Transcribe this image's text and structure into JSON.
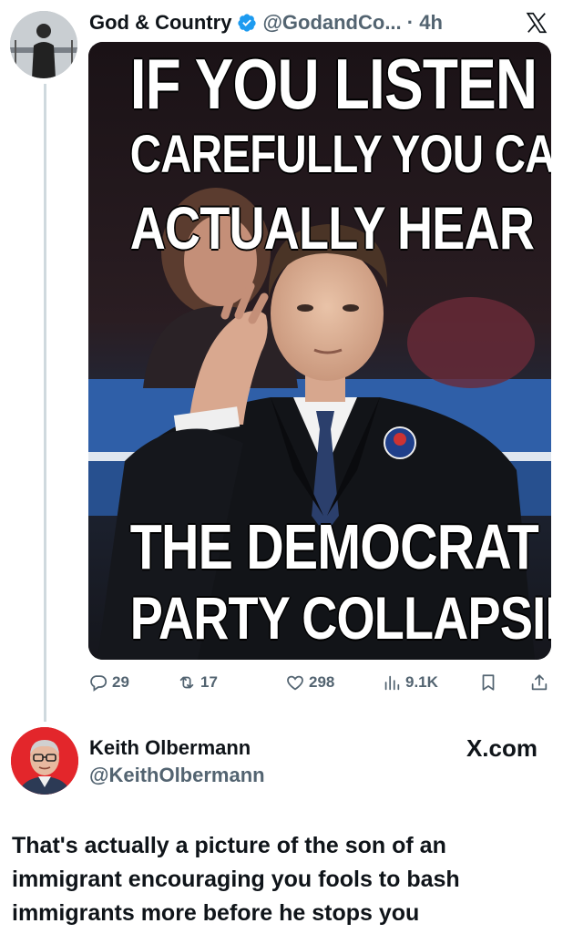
{
  "tweet1": {
    "display_name": "God & Country",
    "handle_time": "@GodandCo... · 4h",
    "meme_text": {
      "line1": "IF YOU LISTEN",
      "line2": "CAREFULLY YOU CAN",
      "line3": "ACTUALLY HEAR",
      "line4": "THE DEMOCRAT",
      "line5": "PARTY COLLAPSING"
    },
    "actions": {
      "replies": "29",
      "reposts": "17",
      "likes": "298",
      "views": "9.1K"
    }
  },
  "tweet2": {
    "display_name": "Keith Olbermann",
    "handle": "@KeithOlbermann",
    "source": "X.com",
    "text_lines": [
      "That's actually a picture of the son of an",
      "immigrant encouraging you fools to bash",
      "immigrants more before he stops you"
    ]
  },
  "colors": {
    "text": "#0f1419",
    "secondary": "#536471",
    "verified": "#1d9bf0",
    "avatar2_bg": "#e3262b"
  },
  "icons": [
    "verified-badge-icon",
    "x-logo-icon",
    "reply-icon",
    "repost-icon",
    "like-icon",
    "views-icon",
    "bookmark-icon",
    "share-icon"
  ]
}
